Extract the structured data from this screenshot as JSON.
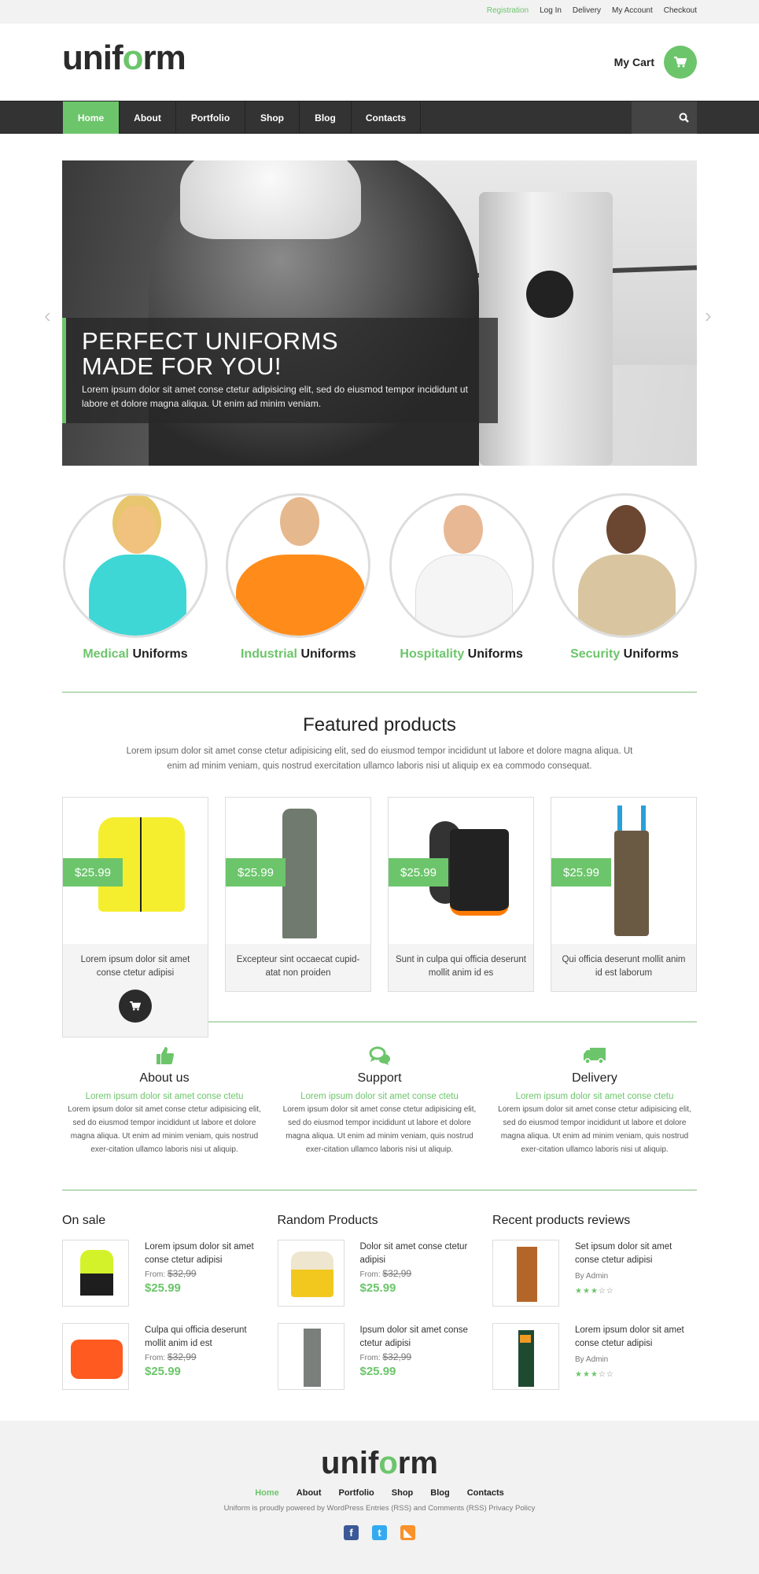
{
  "topbar": {
    "links": [
      "Registration",
      "Log In",
      "Delivery",
      "My Account",
      "Checkout"
    ]
  },
  "header": {
    "logo_pre": "unif",
    "logo_o": "o",
    "logo_post": "rm",
    "cart_label": "My Cart",
    "cart_icon": "shopping-cart-icon"
  },
  "nav": {
    "items": [
      "Home",
      "About",
      "Portfolio",
      "Shop",
      "Blog",
      "Contacts"
    ],
    "active": "Home",
    "search_icon": "search-icon"
  },
  "hero": {
    "title_line1": "PERFECT UNIFORMS",
    "title_line2": "MADE FOR YOU!",
    "text": "Lorem ipsum dolor sit amet conse ctetur adipisicing elit, sed do eiusmod tempor incididunt ut labore et dolore magna aliqua. Ut enim ad minim veniam.",
    "prev_arrow": "‹",
    "next_arrow": "›"
  },
  "categories": [
    {
      "highlight": "Medical",
      "rest": " Uniforms"
    },
    {
      "highlight": "Industrial",
      "rest": " Uniforms"
    },
    {
      "highlight": "Hospitality",
      "rest": " Uniforms"
    },
    {
      "highlight": "Security",
      "rest": " Uniforms"
    }
  ],
  "featured": {
    "title": "Featured products",
    "description": "Lorem ipsum dolor sit amet conse ctetur adipisicing elit, sed do eiusmod tempor incididunt ut labore et dolore magna aliqua. Ut enim ad minim veniam, quis nostrud exercitation ullamco laboris nisi ut aliquip ex ea commodo consequat.",
    "products": [
      {
        "price": "$25.99",
        "name": "Lorem ipsum dolor sit amet conse ctetur adipisi",
        "image": "yellow hi-vis jacket"
      },
      {
        "price": "$25.99",
        "name": "Excepteur sint occaecat cupid-atat non proiden",
        "image": "grey coverall"
      },
      {
        "price": "$25.99",
        "name": "Sunt in culpa qui officia deserunt mollit anim id es",
        "image": "safety boots"
      },
      {
        "price": "$25.99",
        "name": "Qui officia deserunt mollit anim id est laborum",
        "image": "brown bib overalls"
      }
    ]
  },
  "features": [
    {
      "icon": "thumbs-up-icon",
      "title": "About us",
      "subtitle": "Lorem ipsum dolor sit amet conse ctetu",
      "text": "Lorem ipsum dolor sit amet conse ctetur adipisicing elit, sed do eiusmod tempor incididunt ut labore et dolore magna aliqua. Ut enim ad minim veniam, quis nostrud exer-citation ullamco laboris nisi ut aliquip."
    },
    {
      "icon": "chat-bubbles-icon",
      "title": "Support",
      "subtitle": "Lorem ipsum dolor sit amet conse ctetu",
      "text": "Lorem ipsum dolor sit amet conse ctetur adipisicing elit, sed do eiusmod tempor incididunt ut labore et dolore magna aliqua. Ut enim ad minim veniam, quis nostrud exer-citation ullamco laboris nisi ut aliquip."
    },
    {
      "icon": "truck-icon",
      "title": "Delivery",
      "subtitle": "Lorem ipsum dolor sit amet conse ctetu",
      "text": "Lorem ipsum dolor sit amet conse ctetur adipisicing elit, sed do eiusmod tempor incididunt ut labore et dolore magna aliqua. Ut enim ad minim veniam, quis nostrud exer-citation ullamco laboris nisi ut aliquip."
    }
  ],
  "on_sale": {
    "title": "On sale",
    "items": [
      {
        "name": "Lorem ipsum dolor sit amet conse ctetur adipisi",
        "from_label": "From:",
        "old_price": "$32,99",
        "price": "$25.99",
        "image": "hi-vis parka"
      },
      {
        "name": "Culpa qui officia deserunt mollit anim id est",
        "from_label": "From:",
        "old_price": "$32,99",
        "price": "$25.99",
        "image": "orange bomber jacket"
      }
    ]
  },
  "random_products": {
    "title": "Random Products",
    "items": [
      {
        "name": "Dolor sit amet conse ctetur adipisi",
        "from_label": "From:",
        "old_price": "$32,99",
        "price": "$25.99",
        "image": "work gloves"
      },
      {
        "name": "Ipsum dolor sit amet conse ctetur adipisi",
        "from_label": "From:",
        "old_price": "$32,99",
        "price": "$25.99",
        "image": "grey overalls"
      }
    ]
  },
  "recent_reviews": {
    "title": "Recent products reviews",
    "items": [
      {
        "name": "Set ipsum dolor sit amet conse ctetur adipisi",
        "author": "By Admin",
        "rating": 2.5,
        "max_rating": 5,
        "image": "brown bib overalls"
      },
      {
        "name": "Lorem ipsum dolor sit amet conse ctetur adipisi",
        "author": "By Admin",
        "rating": 2.5,
        "max_rating": 5,
        "image": "green chainsaw trousers"
      }
    ]
  },
  "footer": {
    "logo_pre": "unif",
    "logo_o": "o",
    "logo_post": "rm",
    "nav": [
      "Home",
      "About",
      "Portfolio",
      "Shop",
      "Blog",
      "Contacts"
    ],
    "copyright": "Uniform is proudly powered by WordPress Entries (RSS) and Comments (RSS) Privacy Policy",
    "social": [
      {
        "icon": "facebook-icon",
        "glyph": "f",
        "color": "#3b5998"
      },
      {
        "icon": "twitter-icon",
        "glyph": "t",
        "color": "#33aaf0"
      },
      {
        "icon": "rss-icon",
        "glyph": "◣",
        "color": "#f8922a"
      }
    ]
  },
  "colors": {
    "accent": "#6cc56b",
    "nav_bg": "#333333",
    "dark": "#2b2b2b"
  }
}
